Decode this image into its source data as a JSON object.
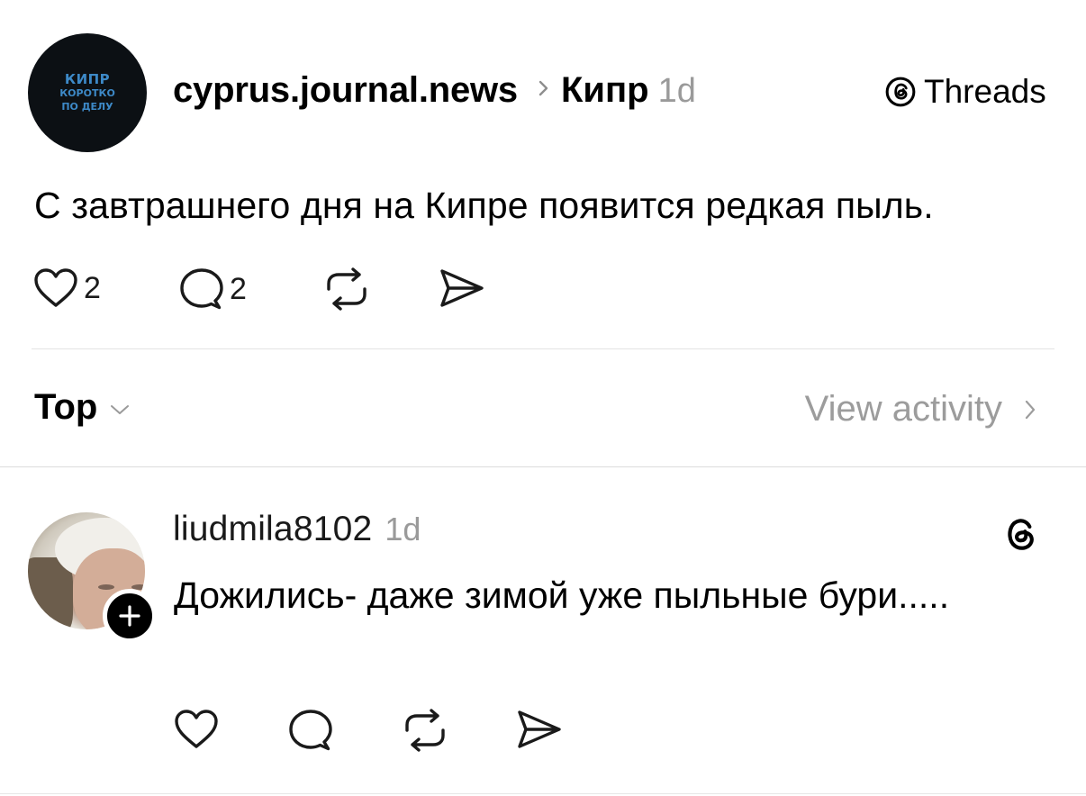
{
  "post": {
    "avatar": {
      "logo_line1": "КИПР",
      "logo_line2": "КОРОТКО",
      "logo_line3": "ПО ДЕЛУ",
      "bg_color": "#0c1014",
      "text_color": "#3d89c7"
    },
    "username": "cyprus.journal.news",
    "topic": "Кипр",
    "time": "1d",
    "brand": "Threads",
    "text": "С завтрашнего дня на Кипре появится редкая пыль.",
    "actions": {
      "like_icon": "heart-icon",
      "like_count": "2",
      "comment_icon": "comment-icon",
      "comment_count": "2",
      "repost_icon": "repost-icon",
      "share_icon": "send-icon"
    }
  },
  "sort": {
    "label": "Top",
    "view_activity": "View activity"
  },
  "reply": {
    "username": "liudmila8102",
    "time": "1d",
    "text": "Дожились- даже зимой уже пыльные бури.....",
    "follow_icon": "plus-icon",
    "threads_icon": "threads-logo-icon"
  },
  "colors": {
    "text": "#000000",
    "muted": "#9a9a9a",
    "divider": "#e3e3e3"
  }
}
